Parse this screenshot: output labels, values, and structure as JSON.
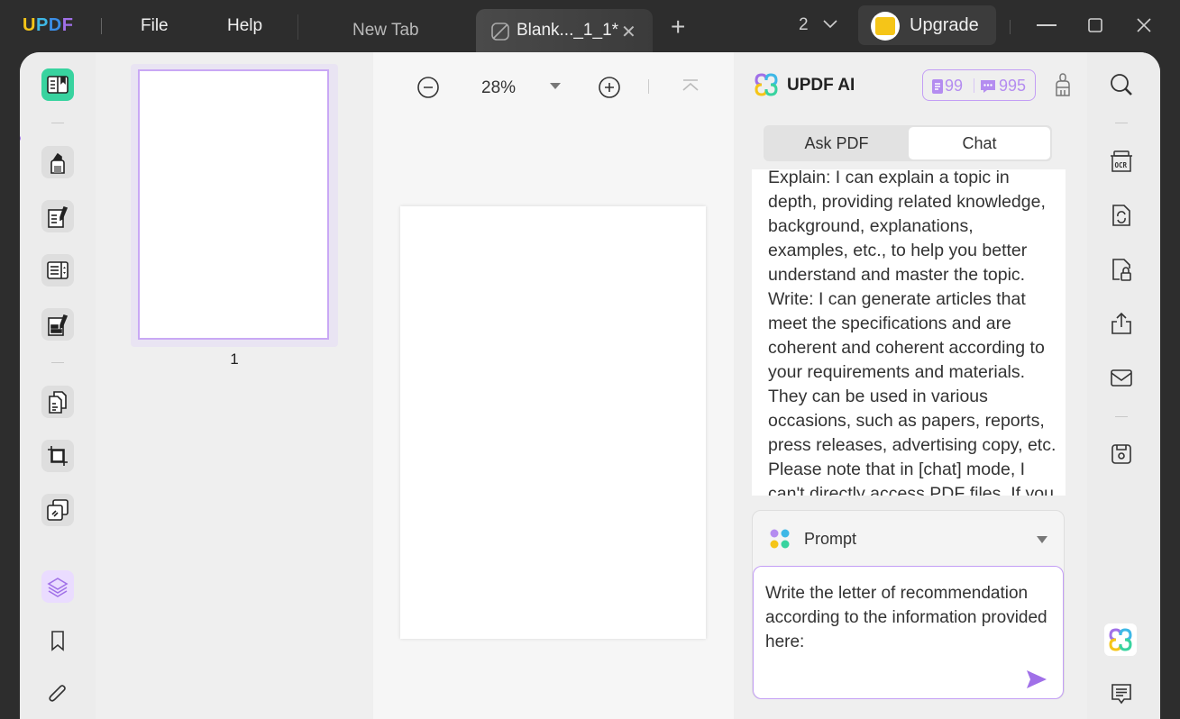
{
  "titlebar": {
    "logo": {
      "u": "U",
      "p": "P",
      "d": "D",
      "f": "F"
    },
    "menu": [
      "File",
      "Help"
    ],
    "tabs": [
      {
        "label": "New Tab",
        "active": false
      },
      {
        "label": "Blank..._1_1*",
        "active": true
      }
    ],
    "page_count": "2",
    "upgrade_label": "Upgrade"
  },
  "left_rail": {
    "items": [
      {
        "name": "reader",
        "active": true
      },
      {
        "name": "comment"
      },
      {
        "name": "edit-pdf"
      },
      {
        "name": "form"
      },
      {
        "name": "fill-sign"
      },
      {
        "name": "organize-pages"
      },
      {
        "name": "crop"
      },
      {
        "name": "redact"
      },
      {
        "name": "layers",
        "highlighted": true
      },
      {
        "name": "bookmark"
      },
      {
        "name": "attachment"
      }
    ]
  },
  "thumbnails": {
    "pages": [
      {
        "number": "1",
        "selected": true
      }
    ]
  },
  "toolbar": {
    "zoom": "28%"
  },
  "ai_panel": {
    "title": "UPDF AI",
    "quota_pdf": "99",
    "quota_chat": "995",
    "tabs": [
      {
        "label": "Ask PDF",
        "active": false
      },
      {
        "label": "Chat",
        "active": true
      }
    ],
    "chat_message": "Explain: I can explain a topic in depth, providing related knowledge, background, explanations, examples, etc., to help you better understand and master the topic. Write: I can generate articles that meet the specifications and are coherent and coherent according to your requirements and materials. They can be used in various occasions, such as papers, reports, press releases, advertising copy, etc. Please note that in [chat] mode, I can't directly access PDF files. If you",
    "prompt_label": "Prompt",
    "input_value": "Write the letter of recommendation according to the information provided here:"
  },
  "right_rail": {
    "items": [
      "search",
      "ocr",
      "convert",
      "protect",
      "share",
      "email",
      "save",
      "updf-ai",
      "comments"
    ]
  },
  "colors": {
    "accent": "#a070e8",
    "active_green": "#38d39f",
    "titlebar_bg": "#2d2d2d"
  }
}
